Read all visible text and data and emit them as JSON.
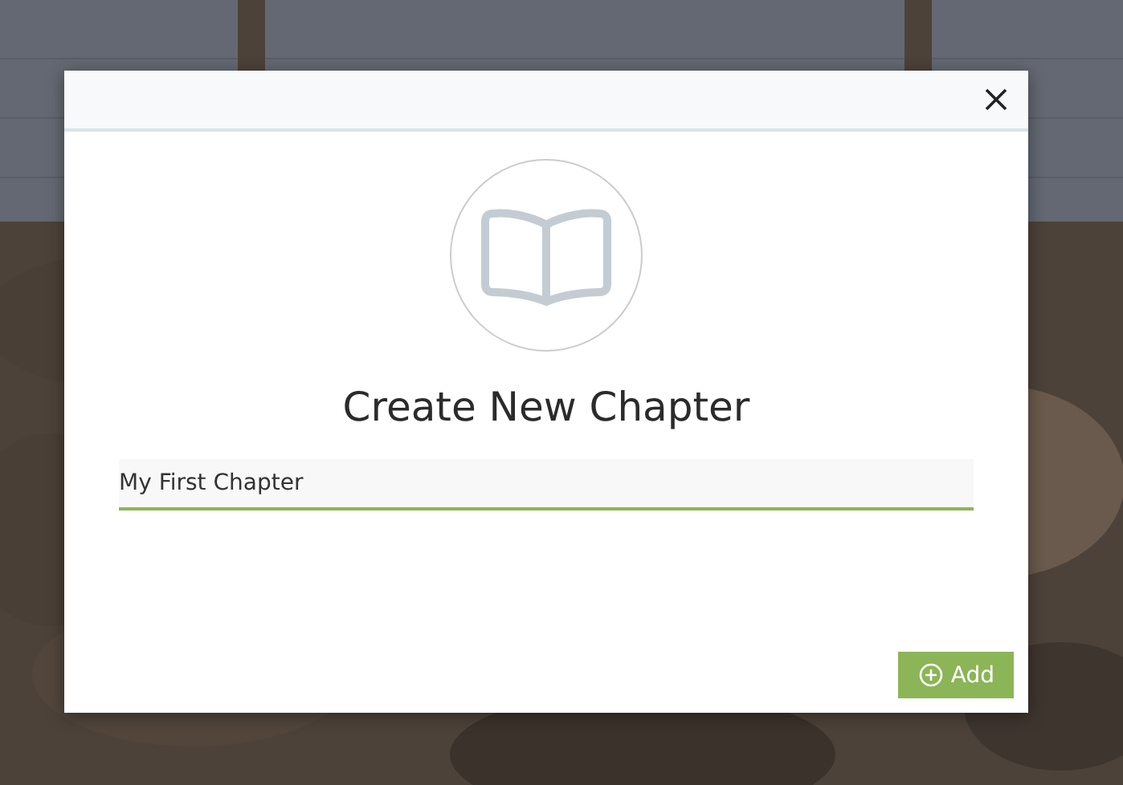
{
  "dialog": {
    "title": "Create New Chapter",
    "field": {
      "value": "My First Chapter"
    },
    "buttons": [
      {
        "label": "Add",
        "kind": "add"
      }
    ]
  }
}
